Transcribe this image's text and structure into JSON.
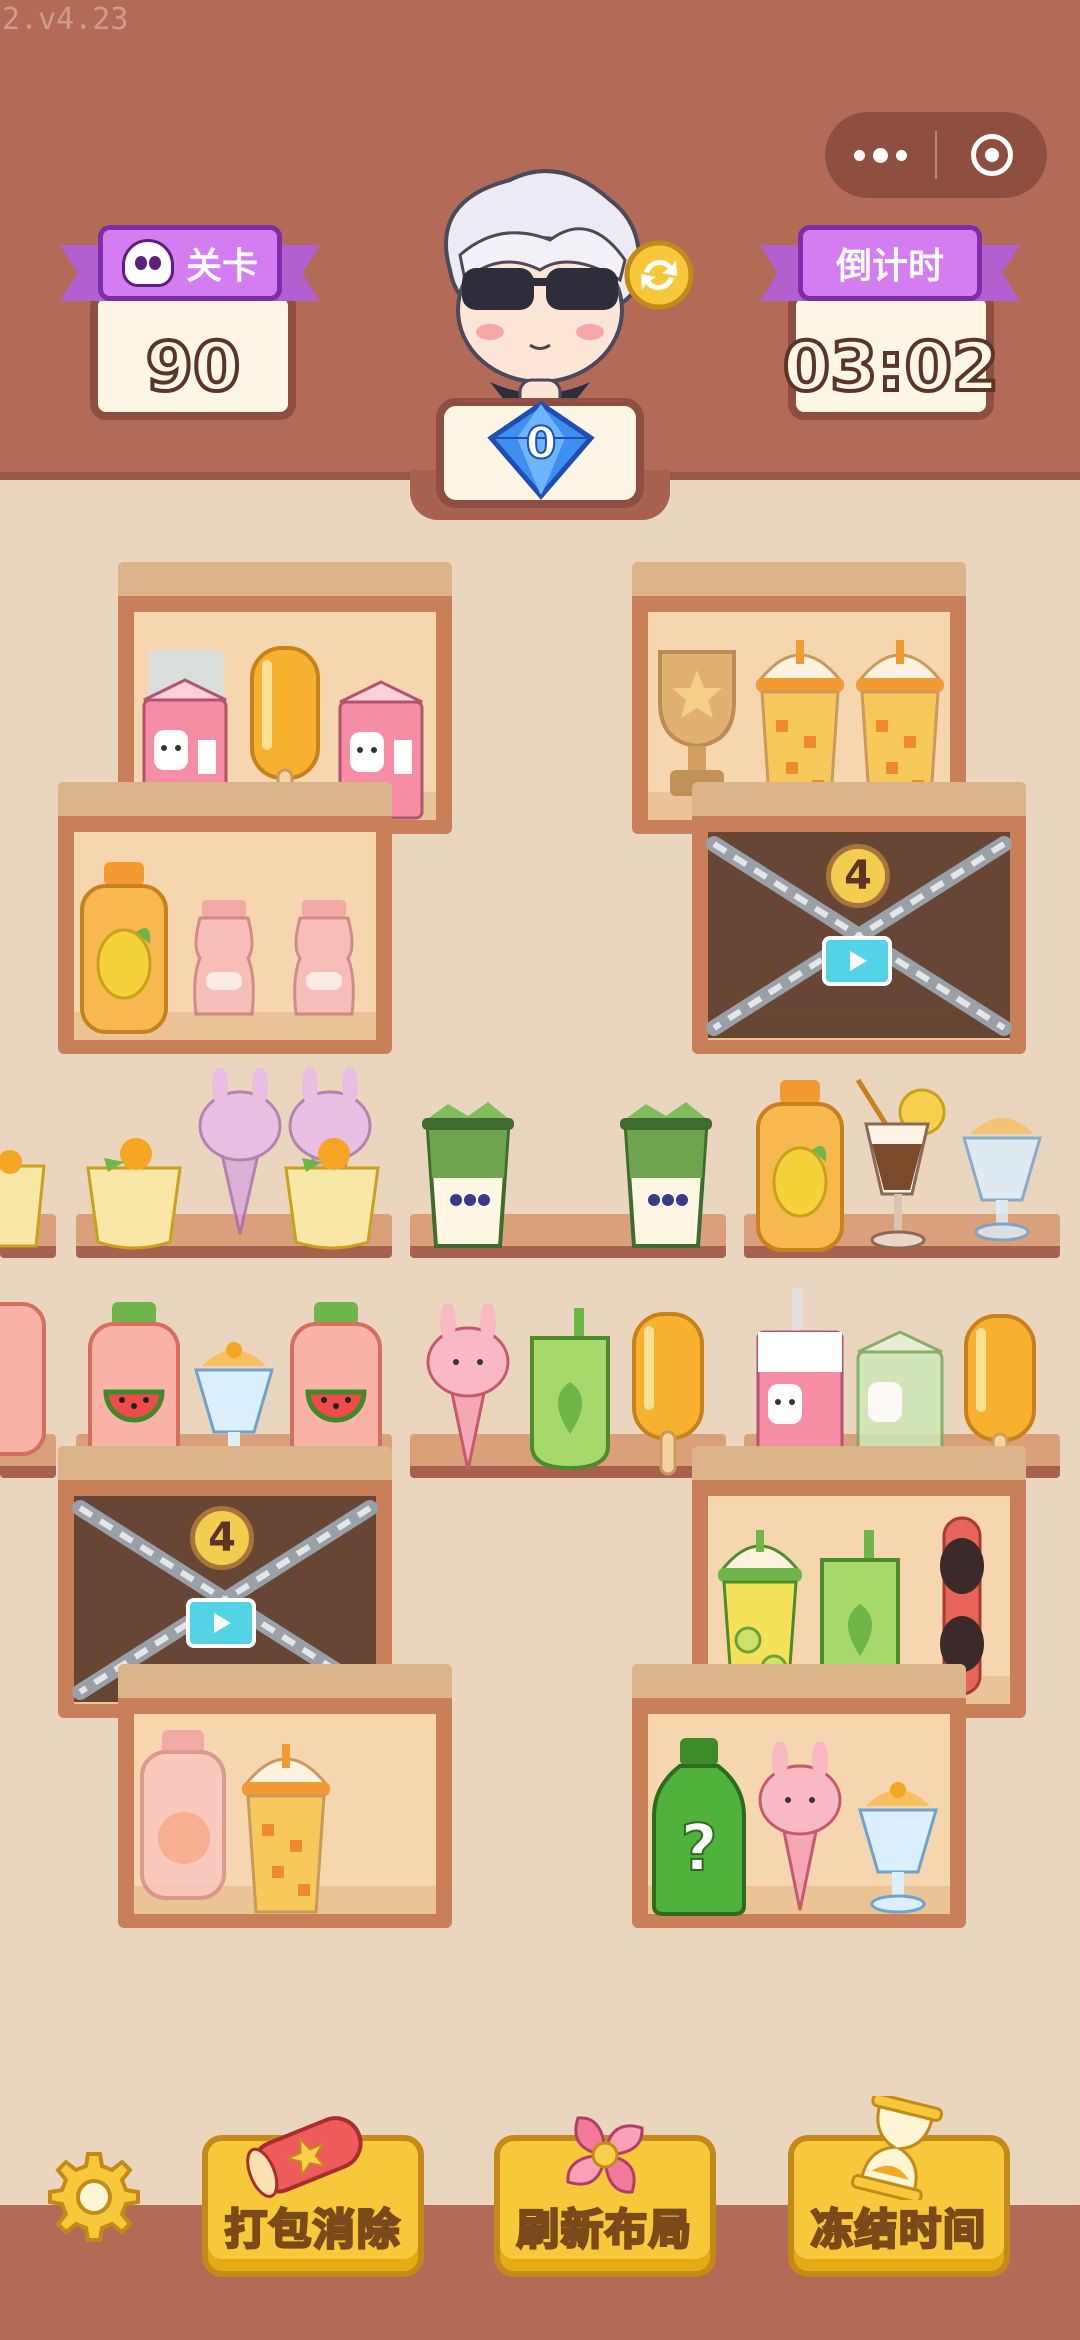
{
  "version": "2.v4.23",
  "header": {
    "level_label": "关卡",
    "level_value": "90",
    "timer_label": "倒计时",
    "timer_value": "03:02",
    "gems": "0"
  },
  "capsule": {
    "more_icon": "more-dots-icon",
    "close_icon": "target-close-icon"
  },
  "locks": [
    {
      "count": "4"
    },
    {
      "count": "4"
    }
  ],
  "mystery_label": "?",
  "actions": [
    {
      "label": "打包消除",
      "icon": "rocket-star-icon"
    },
    {
      "label": "刷新布局",
      "icon": "pinwheel-icon"
    },
    {
      "label": "冻结时间",
      "icon": "hourglass-icon"
    }
  ],
  "settings_icon": "gear-icon",
  "colors": {
    "top_band": "#b36a57",
    "background": "#ead6bf",
    "ribbon": "#d37df0",
    "button": "#f6c83a"
  }
}
